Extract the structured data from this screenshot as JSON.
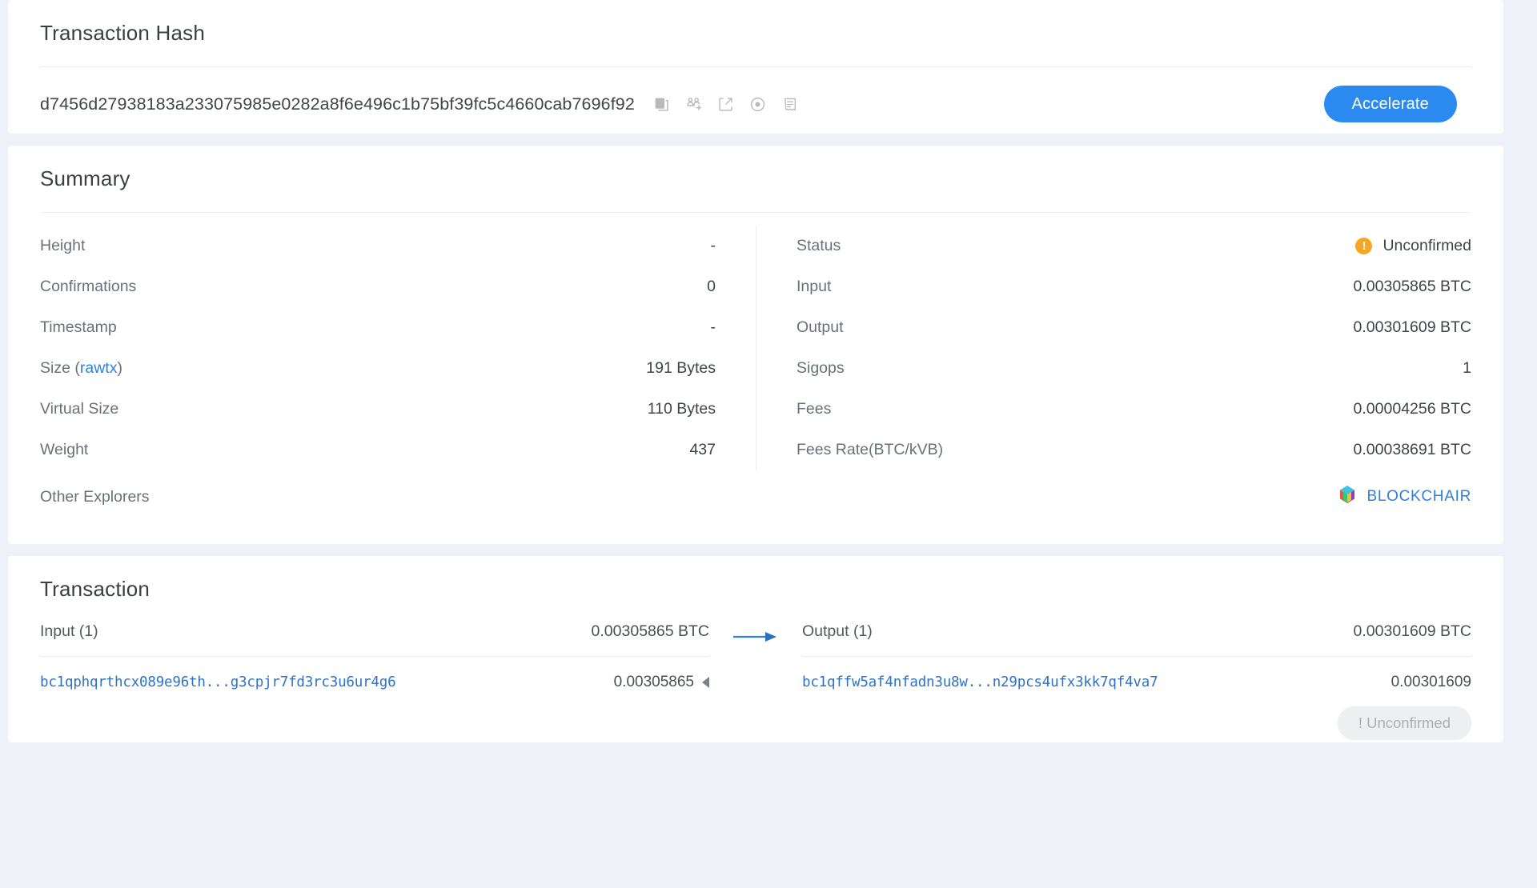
{
  "hash_card": {
    "title": "Transaction Hash",
    "hash": "d7456d27938183a233075985e0282a8f6e496c1b75bf39fc5c4660cab7696f92",
    "icons": [
      "copy-icon",
      "add-to-watchlist-icon",
      "broadcast-icon",
      "target-icon",
      "receipt-icon"
    ],
    "accelerate_label": "Accelerate"
  },
  "summary": {
    "title": "Summary",
    "left": [
      {
        "label": "Height",
        "value": "-"
      },
      {
        "label": "Confirmations",
        "value": "0"
      },
      {
        "label": "Timestamp",
        "value": "-"
      },
      {
        "label": "Size (",
        "link": "rawtx",
        "label_suffix": ")",
        "value": "191 Bytes"
      },
      {
        "label": "Virtual Size",
        "value": "110 Bytes"
      },
      {
        "label": "Weight",
        "value": "437"
      }
    ],
    "right": [
      {
        "label": "Status",
        "value": "Unconfirmed",
        "icon": "warning-circle-icon"
      },
      {
        "label": "Input",
        "value": "0.00305865 BTC"
      },
      {
        "label": "Output",
        "value": "0.00301609 BTC"
      },
      {
        "label": "Sigops",
        "value": "1"
      },
      {
        "label": "Fees",
        "value": "0.00004256 BTC"
      },
      {
        "label": "Fees Rate(BTC/kVB)",
        "value": "0.00038691 BTC"
      }
    ],
    "explorers": {
      "label": "Other Explorers",
      "link_label": "BLOCKCHAIR",
      "logo": "blockchair-cube-icon"
    }
  },
  "transaction": {
    "title": "Transaction",
    "input": {
      "header": "Input (1)",
      "header_amount": "0.00305865 BTC",
      "address": "bc1qphqrthcx089e96th...g3cpjr7fd3rc3u6ur4g6",
      "amount": "0.00305865"
    },
    "output": {
      "header": "Output (1)",
      "header_amount": "0.00301609 BTC",
      "address": "bc1qffw5af4nfadn3u8w...n29pcs4ufx3kk7qf4va7",
      "amount": "0.00301609",
      "badge": "! Unconfirmed"
    },
    "arrow": "arrow-right-icon"
  },
  "colors": {
    "accent_blue": "#2a8af0",
    "link_blue": "#2f80e0",
    "warning_orange": "#f5a623",
    "page_bg": "#eef2f8",
    "card_bg": "#ffffff",
    "badge_bg": "#eeeff1"
  }
}
